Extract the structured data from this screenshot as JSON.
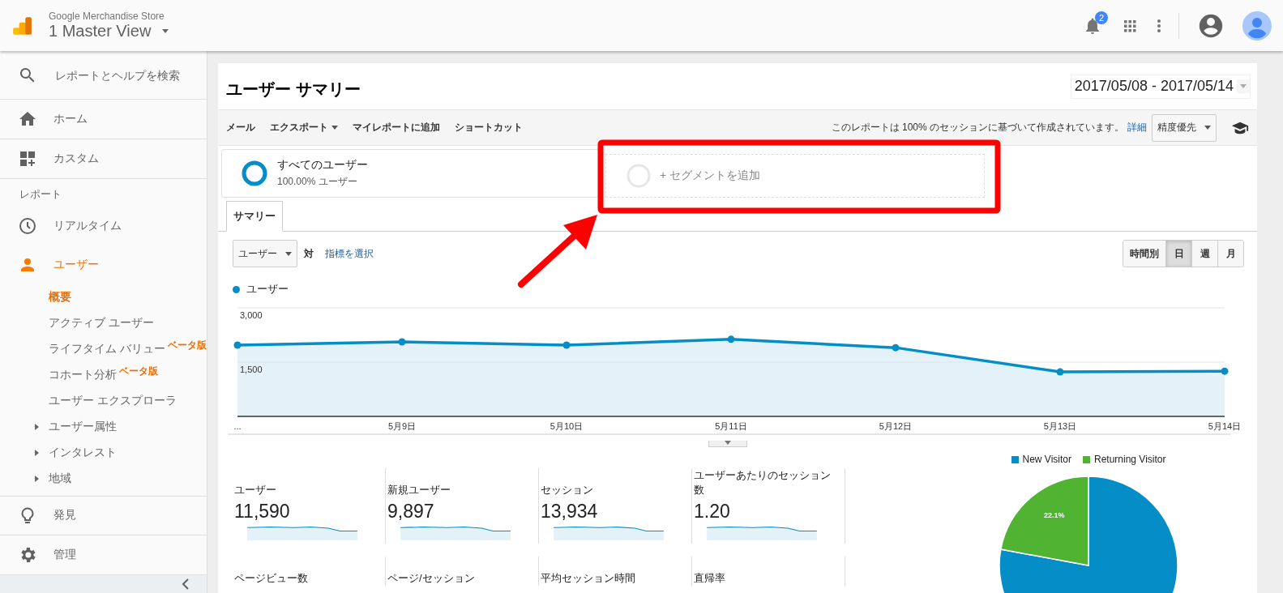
{
  "header": {
    "property": "Google Merchandise Store",
    "view": "1 Master View",
    "notification_count": "2"
  },
  "sidebar": {
    "search_placeholder": "レポートとヘルプを検索",
    "top": [
      {
        "label": "ホーム"
      },
      {
        "label": "カスタム"
      }
    ],
    "section_label": "レポート",
    "reports": [
      {
        "label": "リアルタイム",
        "selected": false
      },
      {
        "label": "ユーザー",
        "selected": true,
        "children": [
          {
            "label": "概要",
            "kind": "page",
            "selected": true
          },
          {
            "label": "アクティブ ユーザー",
            "kind": "page",
            "selected": false
          },
          {
            "label": "ライフタイム バリュー",
            "kind": "page",
            "selected": false,
            "badge": "ベータ版"
          },
          {
            "label": "コホート分析",
            "kind": "page",
            "selected": false,
            "badge": "ベータ版"
          },
          {
            "label": "ユーザー エクスプローラ",
            "kind": "page",
            "selected": false
          },
          {
            "label": "ユーザー属性",
            "kind": "group",
            "selected": false,
            "expanded": false
          },
          {
            "label": "インタレスト",
            "kind": "group",
            "selected": false,
            "expanded": false
          },
          {
            "label": "地域",
            "kind": "group",
            "selected": false,
            "expanded": false
          }
        ]
      }
    ],
    "bottom": [
      {
        "label": "発見"
      },
      {
        "label": "管理"
      }
    ]
  },
  "report": {
    "title": "ユーザー サマリー",
    "date_range": "2017/05/08 - 2017/05/14",
    "actions": [
      {
        "label": "メール",
        "kind": "button"
      },
      {
        "label": "エクスポート",
        "kind": "menu"
      },
      {
        "label": "マイレポートに追加",
        "kind": "button"
      },
      {
        "label": "ショートカット",
        "kind": "button"
      }
    ],
    "sampling_note": "このレポートは 100% のセッションに基づいて作成されています。",
    "sampling_link": "詳細",
    "sampling_mode": "精度優先",
    "segments": [
      {
        "name": "すべてのユーザー",
        "detail": "100.00% ユーザー"
      }
    ],
    "add_segment": "+ セグメントを追加",
    "tabs": [
      {
        "label": "サマリー",
        "selected": true
      }
    ],
    "metric_select": "ユーザー",
    "versus": "対",
    "choose_metric": "指標を選択",
    "granularity": [
      {
        "label": "時間別",
        "selected": false
      },
      {
        "label": "日",
        "selected": true
      },
      {
        "label": "週",
        "selected": false
      },
      {
        "label": "月",
        "selected": false
      }
    ],
    "chart": {
      "chart_data": {
        "type": "area",
        "categories": [
          "...",
          "5月9日",
          "5月10日",
          "5月11日",
          "5月12日",
          "5月13日",
          "5月14日"
        ],
        "series": [
          {
            "name": "ユーザー",
            "color": "#058dc7",
            "values": [
              1970,
              2060,
              1970,
              2130,
              1900,
              1230,
              1250
            ]
          }
        ],
        "ylim": [
          0,
          3000
        ],
        "yticks": [
          {
            "value": 1500,
            "label": "1,500"
          },
          {
            "value": 3000,
            "label": "3,000"
          }
        ]
      }
    },
    "metrics": [
      {
        "label": "ユーザー",
        "value": "11,590"
      },
      {
        "label": "新規ユーザー",
        "value": "9,897"
      },
      {
        "label": "セッション",
        "value": "13,934"
      },
      {
        "label": "ユーザーあたりのセッション数",
        "value": "1.20"
      },
      {
        "label": "ページビュー数"
      },
      {
        "label": "ページ/セッション"
      },
      {
        "label": "平均セッション時間"
      },
      {
        "label": "直帰率"
      }
    ],
    "visitor_chart": {
      "slice_label": "22.1%",
      "chart_data": {
        "type": "pie",
        "categories": [
          "New Visitor",
          "Returning Visitor"
        ],
        "series": [
          {
            "values": [
              77.9,
              22.1
            ]
          }
        ],
        "colors": [
          "#058dc7",
          "#50b432"
        ]
      }
    }
  }
}
